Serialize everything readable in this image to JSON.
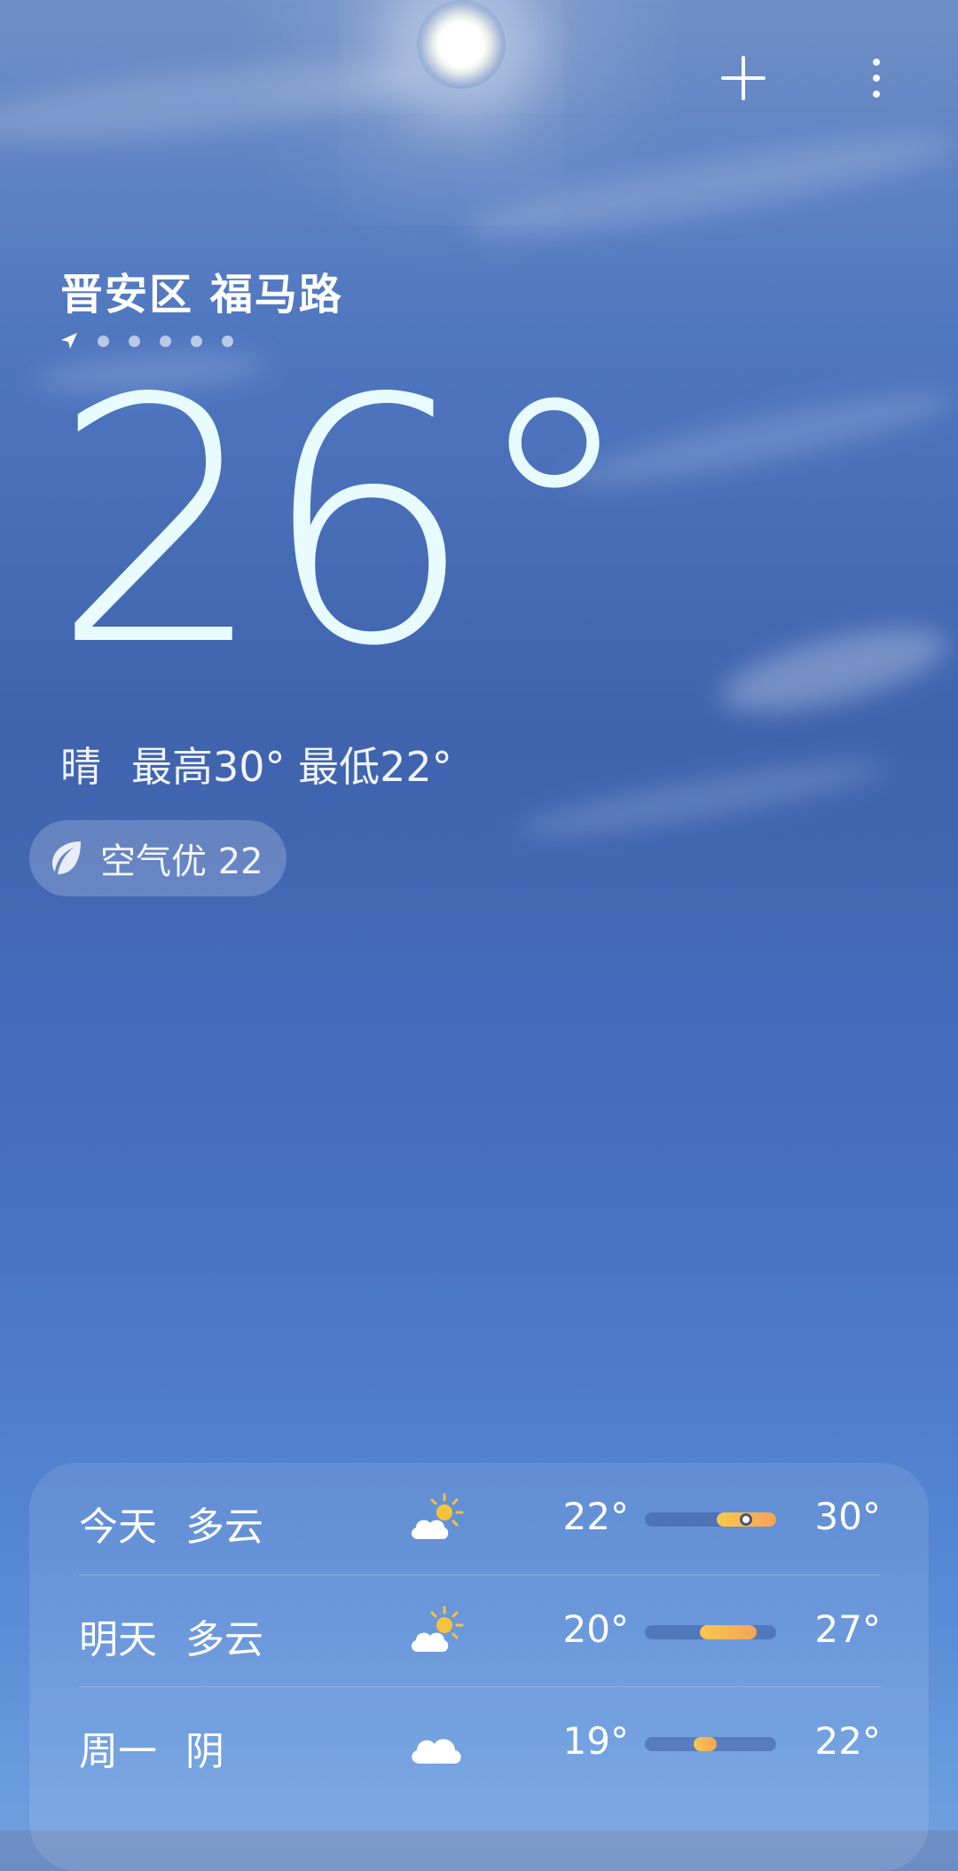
{
  "header": {
    "add_icon": "plus-icon",
    "more_icon": "more-vertical-icon"
  },
  "location": {
    "name": "晋安区 福马路",
    "indicator_icon": "location-arrow-icon",
    "page_count": 6
  },
  "current": {
    "temperature": "26°",
    "condition": "晴",
    "high_low": "最高30° 最低22°"
  },
  "air_quality": {
    "icon": "leaf-icon",
    "label": "空气优 22"
  },
  "forecast": [
    {
      "day": "今天",
      "condition": "多云",
      "icon": "partly-cloudy-icon",
      "low": "22°",
      "high": "30°",
      "range_start": 0.55,
      "range_end": 1.0,
      "current_pos": 0.77
    },
    {
      "day": "明天",
      "condition": "多云",
      "icon": "partly-cloudy-icon",
      "low": "20°",
      "high": "27°",
      "range_start": 0.42,
      "range_end": 0.85
    },
    {
      "day": "周一",
      "condition": "阴",
      "icon": "cloud-icon",
      "low": "19°",
      "high": "22°",
      "range_start": 0.37,
      "range_end": 0.55
    }
  ],
  "colors": {
    "temp_range_start": "#f7c94e",
    "temp_range_end": "#f5a35a",
    "big_temp": "#e8fbff"
  }
}
